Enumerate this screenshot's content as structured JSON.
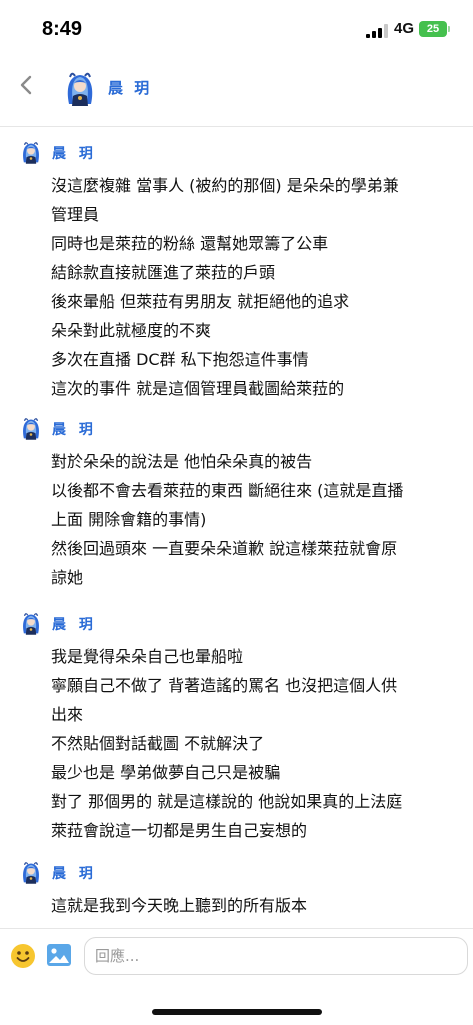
{
  "status_bar": {
    "time": "8:49",
    "network": "4G",
    "battery": "25"
  },
  "header": {
    "name": "晨 玥"
  },
  "messages": [
    {
      "name": "晨 玥",
      "lines": [
        "沒這麼複雜 當事人 (被約的那個) 是朵朵的學弟兼",
        "管理員",
        "同時也是萊菈的粉絲 還幫她眾籌了公車",
        "結餘款直接就匯進了萊菈的戶頭",
        "後來暈船 但萊菈有男朋友 就拒絕他的追求",
        "朵朵對此就極度的不爽",
        "多次在直播 DC群 私下抱怨這件事情",
        "這次的事件 就是這個管理員截圖給萊菈的"
      ]
    },
    {
      "name": "晨 玥",
      "lines": [
        "對於朵朵的說法是 他怕朵朵真的被告",
        "以後都不會去看萊菈的東西 斷絕往來 (這就是直播",
        "上面 開除會籍的事情)",
        "然後回過頭來 一直要朵朵道歉 說這樣萊菈就會原",
        "諒她"
      ]
    },
    {
      "name": "晨 玥",
      "lines": [
        "我是覺得朵朵自己也暈船啦",
        "寧願自己不做了 背著造謠的罵名 也沒把這個人供",
        "出來",
        "不然貼個對話截圖 不就解決了",
        "最少也是 學弟做夢自己只是被騙",
        "對了 那個男的 就是這樣說的 他說如果真的上法庭",
        "萊菈會說這一切都是男生自己妄想的"
      ]
    },
    {
      "name": "晨 玥",
      "lines": [
        "這就是我到今天晚上聽到的所有版本"
      ]
    }
  ],
  "footer": {
    "reply_placeholder": "回應..."
  },
  "colors": {
    "accent": "#2a6bd6",
    "battery": "#45c04e"
  },
  "icons": {
    "back": "chevron-left-icon",
    "emoji": "smiley-icon",
    "image": "image-icon"
  }
}
